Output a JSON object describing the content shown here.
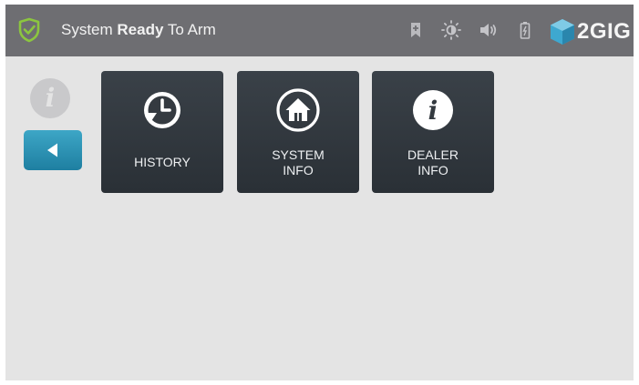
{
  "status": {
    "prefix": "System ",
    "emphasis": "Ready",
    "suffix": " To Arm"
  },
  "brand": {
    "name": "2GIG"
  },
  "topbar_icons": [
    "bookmark-icon",
    "brightness-icon",
    "volume-icon",
    "battery-icon"
  ],
  "sidebar": {
    "info_glyph": "i"
  },
  "tiles": [
    {
      "line1": "HISTORY",
      "line2": ""
    },
    {
      "line1": "SYSTEM",
      "line2": "INFO"
    },
    {
      "line1": "DEALER",
      "line2": "INFO"
    }
  ],
  "colors": {
    "topbar": "#6e6e72",
    "background": "#e4e4e4",
    "accent_blue": "#2b8fb3",
    "shield_green": "#8cc63f",
    "tile_dark": "#2f353b"
  }
}
